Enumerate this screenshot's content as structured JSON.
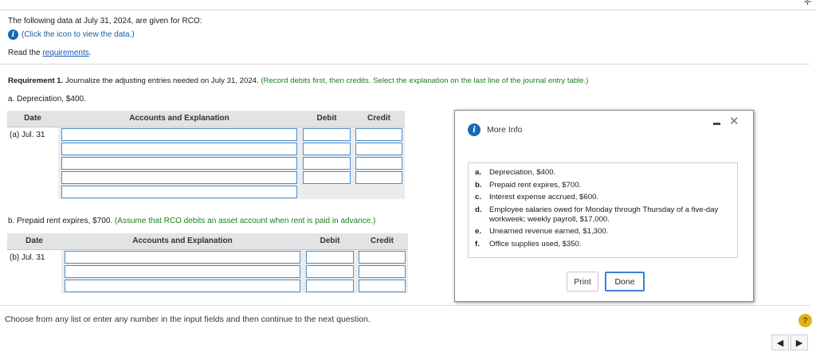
{
  "intro_text": "The following data at July 31, 2024, are given for RCO:",
  "click_icon_text": "(Click the icon to view the data.)",
  "read_prefix": "Read the ",
  "requirements_link": "requirements",
  "read_suffix": ".",
  "requirement": {
    "label": "Requirement 1.",
    "text": " Journalize the adjusting entries needed on July 31, 2024.",
    "instruction": " (Record debits first, then credits. Select the explanation on the last line of the journal entry table.)"
  },
  "part_a": {
    "label": "a. Depreciation, $400."
  },
  "table_headers": {
    "date": "Date",
    "accounts": "Accounts and Explanation",
    "debit": "Debit",
    "credit": "Credit"
  },
  "entry_a": {
    "date": "(a) Jul. 31"
  },
  "part_b": {
    "label": "b. Prepaid rent expires, $700.",
    "note": " (Assume that RCO debits an asset account when rent is paid in advance.)"
  },
  "entry_b": {
    "date": "(b) Jul. 31"
  },
  "footer_text": "Choose from any list or enter any number in the input fields and then continue to the next question.",
  "help_label": "?",
  "dialog": {
    "title": "More Info",
    "close_glyph": "✕",
    "items": [
      {
        "letter": "a.",
        "text": "Depreciation, $400."
      },
      {
        "letter": "b.",
        "text": "Prepaid rent expires, $700."
      },
      {
        "letter": "c.",
        "text": "Interest expense accrued, $600."
      },
      {
        "letter": "d.",
        "text": "Employee salaries owed for Monday through Thursday of a five-day workweek; weekly payroll, $17,000."
      },
      {
        "letter": "e.",
        "text": "Unearned revenue earned, $1,300."
      },
      {
        "letter": "f.",
        "text": "Office supplies used, $350."
      }
    ],
    "print_label": "Print",
    "done_label": "Done"
  },
  "icons": {
    "info": "info-icon",
    "minimize": "minimize-icon",
    "close": "close-icon",
    "prev": "prev-arrow-icon",
    "next": "next-arrow-icon",
    "help": "help-icon"
  },
  "colors": {
    "link": "#1a55b8",
    "instruction_green": "#1d7e1d",
    "input_border": "#4b8fcf",
    "info_blue": "#1769b5",
    "help_yellow": "#e0b319"
  }
}
